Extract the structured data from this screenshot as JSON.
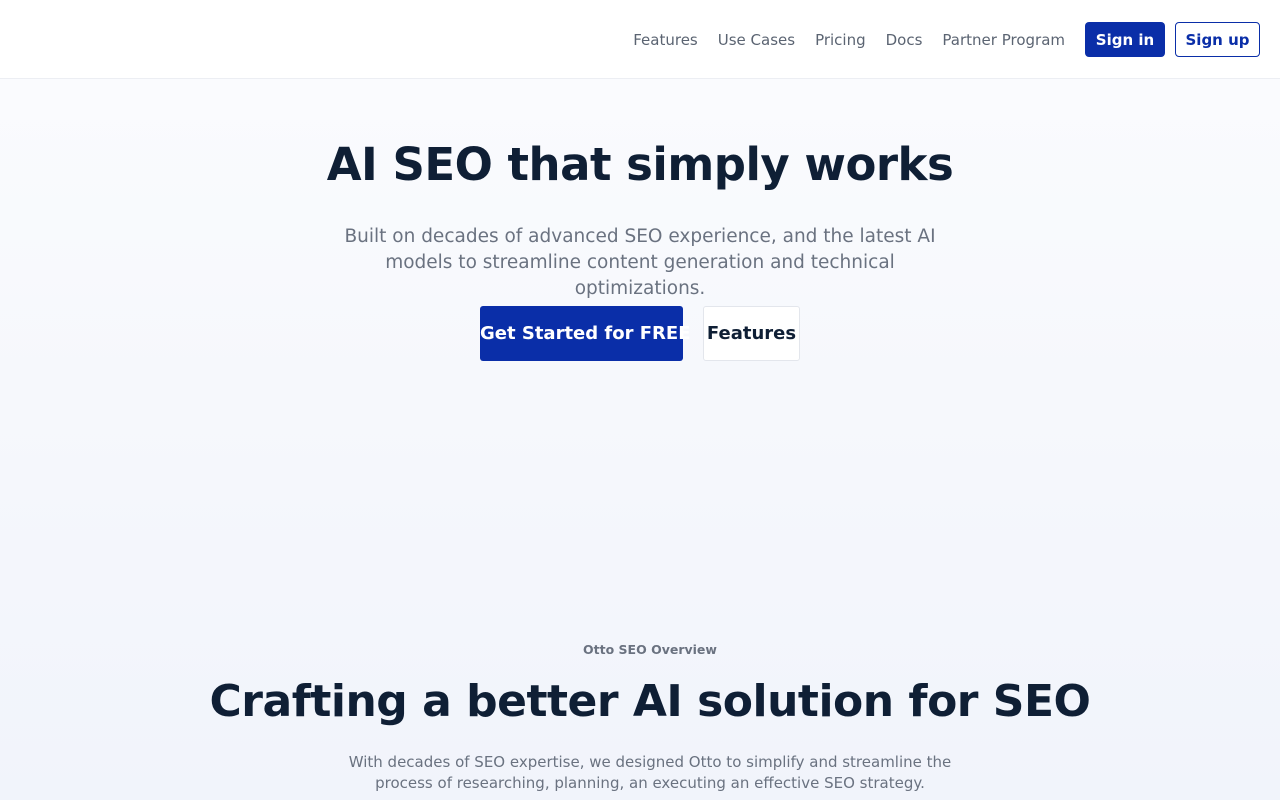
{
  "nav": {
    "links": [
      "Features",
      "Use Cases",
      "Pricing",
      "Docs",
      "Partner Program"
    ],
    "sign_in": "Sign in",
    "sign_up": "Sign up"
  },
  "hero": {
    "title": "AI SEO that simply works",
    "subtitle": "Built on decades of advanced SEO experience, and the latest AI models to streamline content generation and technical optimizations.",
    "cta_primary": "Get Started for FREE",
    "cta_secondary": "Features"
  },
  "overview": {
    "eyebrow": "Otto SEO Overview",
    "title": "Crafting a better AI solution for SEO",
    "subtitle": "With decades of SEO expertise, we designed Otto to simplify and streamline the process of researching, planning, an executing an effective SEO strategy."
  },
  "colors": {
    "brand": "#0a2ea8",
    "heading": "#0f1f35",
    "muted": "#6a7280"
  }
}
